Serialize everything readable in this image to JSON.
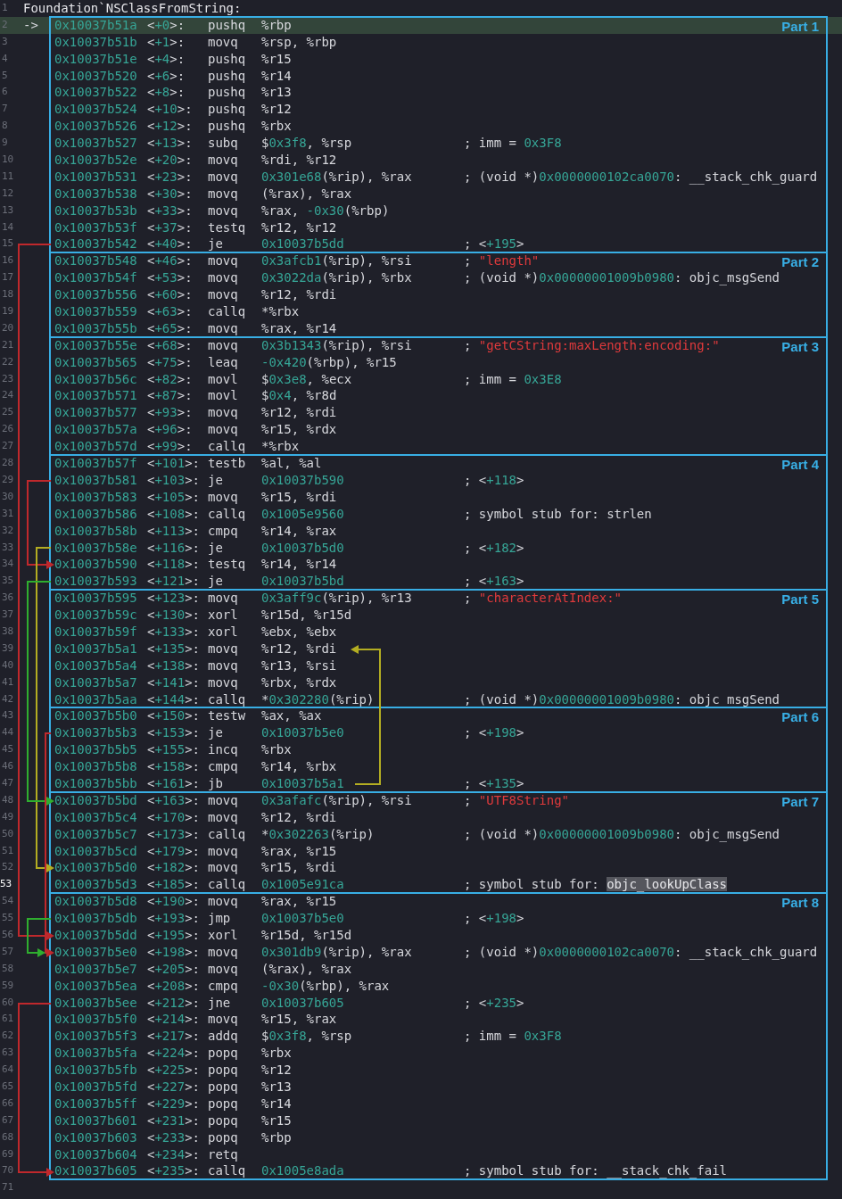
{
  "title_line": {
    "line": "1",
    "text": "Foundation`NSClassFromString:"
  },
  "parts": [
    {
      "label": "Part 1",
      "rows": [
        {
          "line": "2",
          "marker": "->",
          "address": "0x10037b51a",
          "offset": "<+0>:",
          "mnemonic": "pushq",
          "operands": "%rbp",
          "executing": true,
          "selected": false
        },
        {
          "line": "3",
          "address": "0x10037b51b",
          "offset": "<+1>:",
          "mnemonic": "movq",
          "operands": "%rsp, %rbp",
          "executing": false,
          "selected": false
        },
        {
          "line": "4",
          "address": "0x10037b51e",
          "offset": "<+4>:",
          "mnemonic": "pushq",
          "operands": "%r15",
          "executing": false,
          "selected": false
        },
        {
          "line": "5",
          "address": "0x10037b520",
          "offset": "<+6>:",
          "mnemonic": "pushq",
          "operands": "%r14",
          "executing": false,
          "selected": false
        },
        {
          "line": "6",
          "address": "0x10037b522",
          "offset": "<+8>:",
          "mnemonic": "pushq",
          "operands": "%r13",
          "executing": false,
          "selected": false
        },
        {
          "line": "7",
          "address": "0x10037b524",
          "offset": "<+10>:",
          "mnemonic": "pushq",
          "operands": "%r12",
          "executing": false,
          "selected": false
        },
        {
          "line": "8",
          "address": "0x10037b526",
          "offset": "<+12>:",
          "mnemonic": "pushq",
          "operands": "%rbx",
          "executing": false,
          "selected": false
        },
        {
          "line": "9",
          "address": "0x10037b527",
          "offset": "<+13>:",
          "mnemonic": "subq",
          "operands": "$0x3f8, %rsp",
          "comment": "; imm = 0x3F8",
          "executing": false,
          "selected": false
        },
        {
          "line": "10",
          "address": "0x10037b52e",
          "offset": "<+20>:",
          "mnemonic": "movq",
          "operands": "%rdi, %r12",
          "executing": false,
          "selected": false
        },
        {
          "line": "11",
          "address": "0x10037b531",
          "offset": "<+23>:",
          "mnemonic": "movq",
          "operands": "0x301e68(%rip), %rax",
          "comment": "; (void *)0x0000000102ca0070: __stack_chk_guard",
          "executing": false,
          "selected": false
        },
        {
          "line": "12",
          "address": "0x10037b538",
          "offset": "<+30>:",
          "mnemonic": "movq",
          "operands": "(%rax), %rax",
          "executing": false,
          "selected": false
        },
        {
          "line": "13",
          "address": "0x10037b53b",
          "offset": "<+33>:",
          "mnemonic": "movq",
          "operands": "%rax, -0x30(%rbp)",
          "executing": false,
          "selected": false
        },
        {
          "line": "14",
          "address": "0x10037b53f",
          "offset": "<+37>:",
          "mnemonic": "testq",
          "operands": "%r12, %r12",
          "executing": false,
          "selected": false
        },
        {
          "line": "15",
          "address": "0x10037b542",
          "offset": "<+40>:",
          "mnemonic": "je",
          "operands": "0x10037b5dd",
          "comment": "; <+195>",
          "branch": {
            "kind": "outer",
            "color": "#c0282c"
          },
          "executing": false,
          "selected": false
        }
      ]
    },
    {
      "label": "Part 2",
      "rows": [
        {
          "line": "16",
          "address": "0x10037b548",
          "offset": "<+46>:",
          "mnemonic": "movq",
          "operands": "0x3afcb1(%rip), %rsi",
          "comment": "; \"length\"",
          "executing": false,
          "selected": false
        },
        {
          "line": "17",
          "address": "0x10037b54f",
          "offset": "<+53>:",
          "mnemonic": "movq",
          "operands": "0x3022da(%rip), %rbx",
          "comment": "; (void *)0x00000001009b0980: objc_msgSend",
          "executing": false,
          "selected": false
        },
        {
          "line": "18",
          "address": "0x10037b556",
          "offset": "<+60>:",
          "mnemonic": "movq",
          "operands": "%r12, %rdi",
          "executing": false,
          "selected": false
        },
        {
          "line": "19",
          "address": "0x10037b559",
          "offset": "<+63>:",
          "mnemonic": "callq",
          "operands": "*%rbx",
          "executing": false,
          "selected": false
        },
        {
          "line": "20",
          "address": "0x10037b55b",
          "offset": "<+65>:",
          "mnemonic": "movq",
          "operands": "%rax, %r14",
          "executing": false,
          "selected": false
        }
      ]
    },
    {
      "label": "Part 3",
      "rows": [
        {
          "line": "21",
          "address": "0x10037b55e",
          "offset": "<+68>:",
          "mnemonic": "movq",
          "operands": "0x3b1343(%rip), %rsi",
          "comment": "; \"getCString:maxLength:encoding:\"",
          "executing": false,
          "selected": false
        },
        {
          "line": "22",
          "address": "0x10037b565",
          "offset": "<+75>:",
          "mnemonic": "leaq",
          "operands": "-0x420(%rbp), %r15",
          "executing": false,
          "selected": false
        },
        {
          "line": "23",
          "address": "0x10037b56c",
          "offset": "<+82>:",
          "mnemonic": "movl",
          "operands": "$0x3e8, %ecx",
          "comment": "; imm = 0x3E8",
          "executing": false,
          "selected": false
        },
        {
          "line": "24",
          "address": "0x10037b571",
          "offset": "<+87>:",
          "mnemonic": "movl",
          "operands": "$0x4, %r8d",
          "executing": false,
          "selected": false
        },
        {
          "line": "25",
          "address": "0x10037b577",
          "offset": "<+93>:",
          "mnemonic": "movq",
          "operands": "%r12, %rdi",
          "executing": false,
          "selected": false
        },
        {
          "line": "26",
          "address": "0x10037b57a",
          "offset": "<+96>:",
          "mnemonic": "movq",
          "operands": "%r15, %rdx",
          "executing": false,
          "selected": false
        },
        {
          "line": "27",
          "address": "0x10037b57d",
          "offset": "<+99>:",
          "mnemonic": "callq",
          "operands": "*%rbx",
          "executing": false,
          "selected": false
        }
      ]
    },
    {
      "label": "Part 4",
      "rows": [
        {
          "line": "28",
          "address": "0x10037b57f",
          "offset": "<+101>:",
          "mnemonic": "testb",
          "operands": "%al, %al",
          "executing": false,
          "selected": false
        },
        {
          "line": "29",
          "address": "0x10037b581",
          "offset": "<+103>:",
          "mnemonic": "je",
          "operands": "0x10037b590",
          "comment": "; <+118>",
          "branch": {
            "kind": "second",
            "color": "#c0282c"
          },
          "executing": false,
          "selected": false
        },
        {
          "line": "30",
          "address": "0x10037b583",
          "offset": "<+105>:",
          "mnemonic": "movq",
          "operands": "%r15, %rdi",
          "executing": false,
          "selected": false
        },
        {
          "line": "31",
          "address": "0x10037b586",
          "offset": "<+108>:",
          "mnemonic": "callq",
          "operands": "0x1005e9560",
          "comment": "; symbol stub for: strlen",
          "executing": false,
          "selected": false
        },
        {
          "line": "32",
          "address": "0x10037b58b",
          "offset": "<+113>:",
          "mnemonic": "cmpq",
          "operands": "%r14, %rax",
          "executing": false,
          "selected": false
        },
        {
          "line": "33",
          "address": "0x10037b58e",
          "offset": "<+116>:",
          "mnemonic": "je",
          "operands": "0x10037b5d0",
          "comment": "; <+182>",
          "branch": {
            "kind": "third",
            "color": "#b3ad22"
          },
          "executing": false,
          "selected": false
        },
        {
          "line": "34",
          "address": "0x10037b590",
          "offset": "<+118>:",
          "mnemonic": "testq",
          "operands": "%r14, %r14",
          "executing": false,
          "selected": false
        },
        {
          "line": "35",
          "address": "0x10037b593",
          "offset": "<+121>:",
          "mnemonic": "je",
          "operands": "0x10037b5bd",
          "comment": "; <+163>",
          "branch": {
            "kind": "second",
            "color": "#2fae2f"
          },
          "executing": false,
          "selected": false
        }
      ]
    },
    {
      "label": "Part 5",
      "rows": [
        {
          "line": "36",
          "address": "0x10037b595",
          "offset": "<+123>:",
          "mnemonic": "movq",
          "operands": "0x3aff9c(%rip), %r13",
          "comment": "; \"characterAtIndex:\"",
          "executing": false,
          "selected": false
        },
        {
          "line": "37",
          "address": "0x10037b59c",
          "offset": "<+130>:",
          "mnemonic": "xorl",
          "operands": "%r15d, %r15d",
          "executing": false,
          "selected": false
        },
        {
          "line": "38",
          "address": "0x10037b59f",
          "offset": "<+133>:",
          "mnemonic": "xorl",
          "operands": "%ebx, %ebx",
          "executing": false,
          "selected": false
        },
        {
          "line": "39",
          "address": "0x10037b5a1",
          "offset": "<+135>:",
          "mnemonic": "movq",
          "operands": "%r12, %rdi",
          "executing": false,
          "selected": false
        },
        {
          "line": "40",
          "address": "0x10037b5a4",
          "offset": "<+138>:",
          "mnemonic": "movq",
          "operands": "%r13, %rsi",
          "executing": false,
          "selected": false
        },
        {
          "line": "41",
          "address": "0x10037b5a7",
          "offset": "<+141>:",
          "mnemonic": "movq",
          "operands": "%rbx, %rdx",
          "executing": false,
          "selected": false
        },
        {
          "line": "42",
          "address": "0x10037b5aa",
          "offset": "<+144>:",
          "mnemonic": "callq",
          "operands": "*0x302280(%rip)",
          "comment": "; (void *)0x00000001009b0980: objc_msgSend",
          "executing": false,
          "selected": false
        }
      ]
    },
    {
      "label": "Part 6",
      "rows": [
        {
          "line": "43",
          "address": "0x10037b5b0",
          "offset": "<+150>:",
          "mnemonic": "testw",
          "operands": "%ax, %ax",
          "executing": false,
          "selected": false
        },
        {
          "line": "44",
          "address": "0x10037b5b3",
          "offset": "<+153>:",
          "mnemonic": "je",
          "operands": "0x10037b5e0",
          "comment": "; <+198>",
          "branch": {
            "kind": "inner",
            "color": "#c0282c"
          },
          "executing": false,
          "selected": false
        },
        {
          "line": "45",
          "address": "0x10037b5b5",
          "offset": "<+155>:",
          "mnemonic": "incq",
          "operands": "%rbx",
          "executing": false,
          "selected": false
        },
        {
          "line": "46",
          "address": "0x10037b5b8",
          "offset": "<+158>:",
          "mnemonic": "cmpq",
          "operands": "%r14, %rbx",
          "executing": false,
          "selected": false
        },
        {
          "line": "47",
          "address": "0x10037b5bb",
          "offset": "<+161>:",
          "mnemonic": "jb",
          "operands": "0x10037b5a1",
          "comment": "; <+135>",
          "branch": {
            "kind": "loop",
            "color": "#b3ad22"
          },
          "executing": false,
          "selected": false
        }
      ]
    },
    {
      "label": "Part 7",
      "rows": [
        {
          "line": "48",
          "address": "0x10037b5bd",
          "offset": "<+163>:",
          "mnemonic": "movq",
          "operands": "0x3afafc(%rip), %rsi",
          "comment": "; \"UTF8String\"",
          "executing": false,
          "selected": false
        },
        {
          "line": "49",
          "address": "0x10037b5c4",
          "offset": "<+170>:",
          "mnemonic": "movq",
          "operands": "%r12, %rdi",
          "executing": false,
          "selected": false
        },
        {
          "line": "50",
          "address": "0x10037b5c7",
          "offset": "<+173>:",
          "mnemonic": "callq",
          "operands": "*0x302263(%rip)",
          "comment": "; (void *)0x00000001009b0980: objc_msgSend",
          "executing": false,
          "selected": false
        },
        {
          "line": "51",
          "address": "0x10037b5cd",
          "offset": "<+179>:",
          "mnemonic": "movq",
          "operands": "%rax, %r15",
          "executing": false,
          "selected": false
        },
        {
          "line": "52",
          "address": "0x10037b5d0",
          "offset": "<+182>:",
          "mnemonic": "movq",
          "operands": "%r15, %rdi",
          "executing": false,
          "selected": false
        },
        {
          "line": "53",
          "address": "0x10037b5d3",
          "offset": "<+185>:",
          "mnemonic": "callq",
          "operands": "0x1005e91ca",
          "comment": "; symbol stub for: ",
          "highlight": "objc_lookUpClass",
          "executing": false,
          "selected": true
        }
      ]
    },
    {
      "label": "Part 8",
      "rows": [
        {
          "line": "54",
          "address": "0x10037b5d8",
          "offset": "<+190>:",
          "mnemonic": "movq",
          "operands": "%rax, %r15",
          "executing": false,
          "selected": false
        },
        {
          "line": "55",
          "address": "0x10037b5db",
          "offset": "<+193>:",
          "mnemonic": "jmp",
          "operands": "0x10037b5e0",
          "comment": "; <+198>",
          "branch": {
            "kind": "second",
            "color": "#2fae2f"
          },
          "executing": false,
          "selected": false
        },
        {
          "line": "56",
          "address": "0x10037b5dd",
          "offset": "<+195>:",
          "mnemonic": "xorl",
          "operands": "%r15d, %r15d",
          "executing": false,
          "selected": false
        },
        {
          "line": "57",
          "address": "0x10037b5e0",
          "offset": "<+198>:",
          "mnemonic": "movq",
          "operands": "0x301db9(%rip), %rax",
          "comment": "; (void *)0x0000000102ca0070: __stack_chk_guard",
          "executing": false,
          "selected": false
        },
        {
          "line": "58",
          "address": "0x10037b5e7",
          "offset": "<+205>:",
          "mnemonic": "movq",
          "operands": "(%rax), %rax",
          "executing": false,
          "selected": false
        },
        {
          "line": "59",
          "address": "0x10037b5ea",
          "offset": "<+208>:",
          "mnemonic": "cmpq",
          "operands": "-0x30(%rbp), %rax",
          "executing": false,
          "selected": false
        },
        {
          "line": "60",
          "address": "0x10037b5ee",
          "offset": "<+212>:",
          "mnemonic": "jne",
          "operands": "0x10037b605",
          "comment": "; <+235>",
          "branch": {
            "kind": "outer",
            "color": "#c0282c"
          },
          "executing": false,
          "selected": false
        },
        {
          "line": "61",
          "address": "0x10037b5f0",
          "offset": "<+214>:",
          "mnemonic": "movq",
          "operands": "%r15, %rax",
          "executing": false,
          "selected": false
        },
        {
          "line": "62",
          "address": "0x10037b5f3",
          "offset": "<+217>:",
          "mnemonic": "addq",
          "operands": "$0x3f8, %rsp",
          "comment": "; imm = 0x3F8",
          "executing": false,
          "selected": false
        },
        {
          "line": "63",
          "address": "0x10037b5fa",
          "offset": "<+224>:",
          "mnemonic": "popq",
          "operands": "%rbx",
          "executing": false,
          "selected": false
        },
        {
          "line": "64",
          "address": "0x10037b5fb",
          "offset": "<+225>:",
          "mnemonic": "popq",
          "operands": "%r12",
          "executing": false,
          "selected": false
        },
        {
          "line": "65",
          "address": "0x10037b5fd",
          "offset": "<+227>:",
          "mnemonic": "popq",
          "operands": "%r13",
          "executing": false,
          "selected": false
        },
        {
          "line": "66",
          "address": "0x10037b5ff",
          "offset": "<+229>:",
          "mnemonic": "popq",
          "operands": "%r14",
          "executing": false,
          "selected": false
        },
        {
          "line": "67",
          "address": "0x10037b601",
          "offset": "<+231>:",
          "mnemonic": "popq",
          "operands": "%r15",
          "executing": false,
          "selected": false
        },
        {
          "line": "68",
          "address": "0x10037b603",
          "offset": "<+233>:",
          "mnemonic": "popq",
          "operands": "%rbp",
          "executing": false,
          "selected": false
        },
        {
          "line": "69",
          "address": "0x10037b604",
          "offset": "<+234>:",
          "mnemonic": "retq",
          "executing": false,
          "selected": false
        },
        {
          "line": "70",
          "address": "0x10037b605",
          "offset": "<+235>:",
          "mnemonic": "callq",
          "operands": "0x1005e8ada",
          "comment": "; symbol stub for: __stack_chk_fail",
          "executing": false,
          "selected": false
        }
      ]
    }
  ],
  "end_line": {
    "line": "71"
  }
}
